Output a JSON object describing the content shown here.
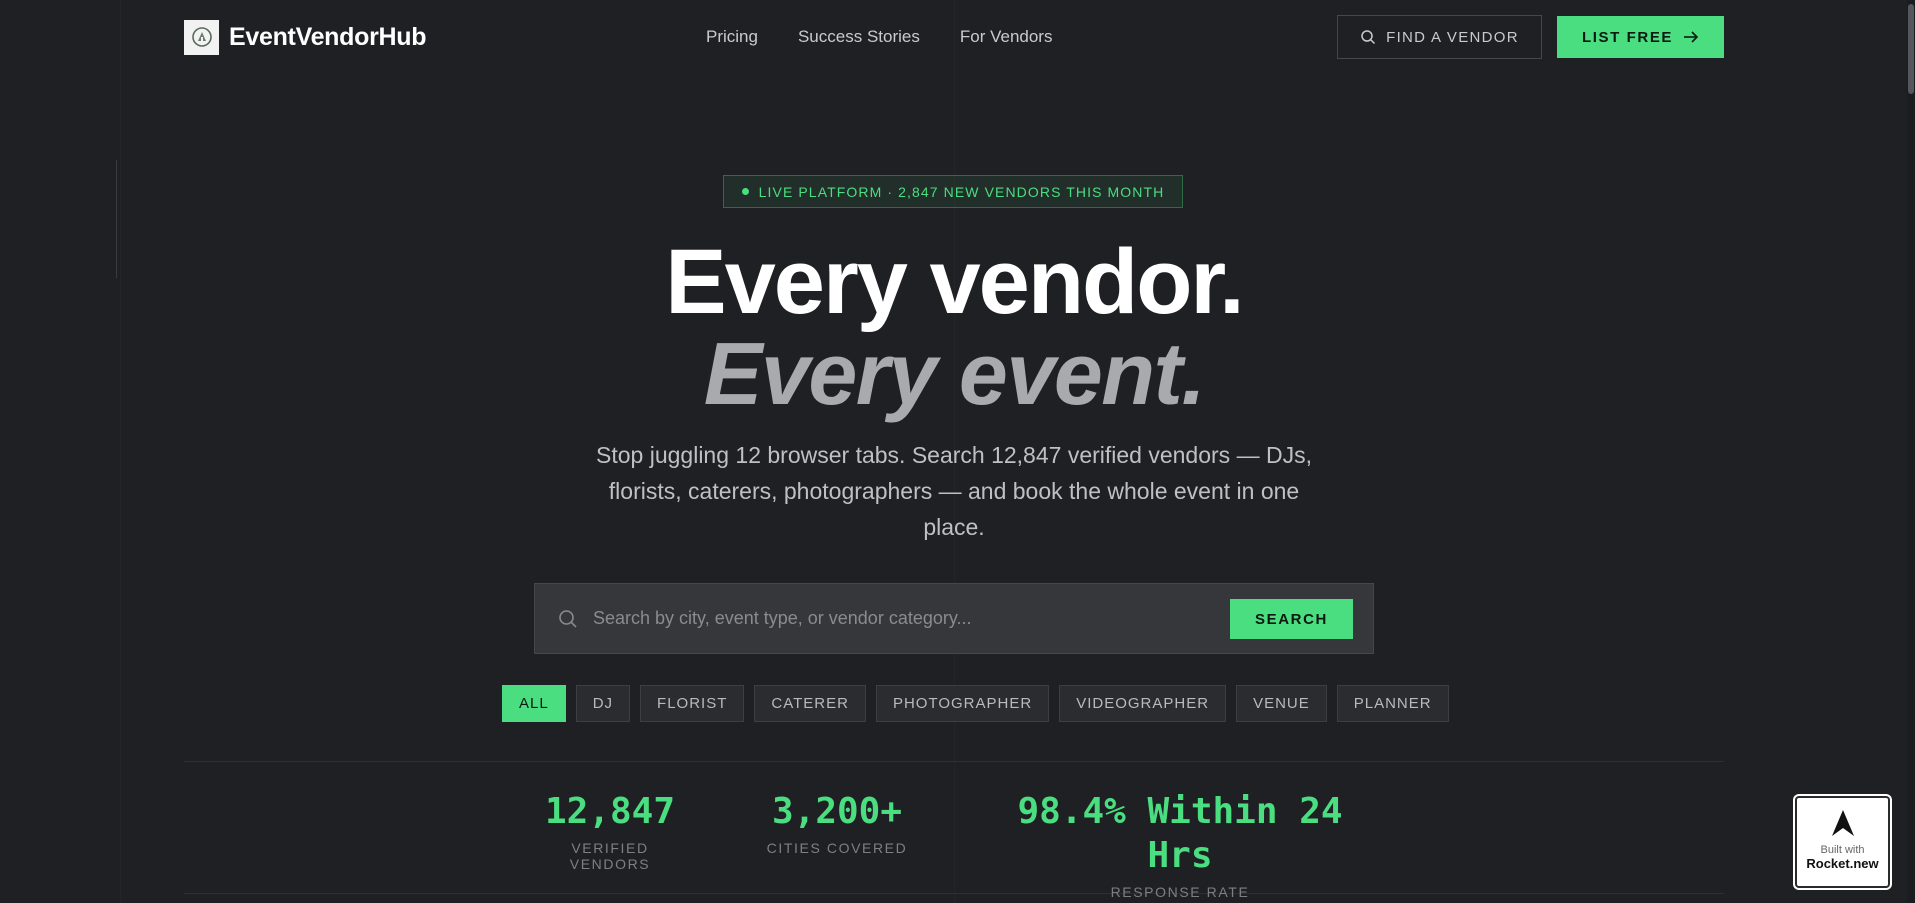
{
  "header": {
    "logo_text": "EventVendorHub",
    "nav": [
      "Pricing",
      "Success Stories",
      "For Vendors"
    ],
    "find_vendor_label": "FIND A VENDOR",
    "list_free_label": "LIST FREE"
  },
  "hero": {
    "badge": "LIVE PLATFORM · 2,847 NEW VENDORS THIS MONTH",
    "title_line1": "Every vendor.",
    "title_line2": "Every event.",
    "subtitle": "Stop juggling 12 browser tabs. Search 12,847 verified vendors — DJs, florists, caterers, photographers — and book the whole event in one place."
  },
  "search": {
    "placeholder": "Search by city, event type, or vendor category...",
    "button_label": "SEARCH"
  },
  "filters": {
    "items": [
      "ALL",
      "DJ",
      "FLORIST",
      "CATERER",
      "PHOTOGRAPHER",
      "VIDEOGRAPHER",
      "VENUE",
      "PLANNER"
    ],
    "active": "ALL"
  },
  "stats": [
    {
      "value": "12,847",
      "label": "VERIFIED VENDORS"
    },
    {
      "value": "3,200+",
      "label": "CITIES COVERED"
    },
    {
      "value": "98.4% Within 24 Hrs",
      "label": "RESPONSE RATE"
    }
  ],
  "rocket_badge": {
    "built_with": "Built with",
    "name": "Rocket.new"
  },
  "colors": {
    "background": "#1f2023",
    "accent": "#4ade80",
    "search_bg": "#36373b",
    "muted_text": "#a9aaad"
  },
  "icons": [
    "logo-icon",
    "search-icon",
    "arrow-right-icon",
    "badge-dot-icon",
    "rocket-icon"
  ]
}
